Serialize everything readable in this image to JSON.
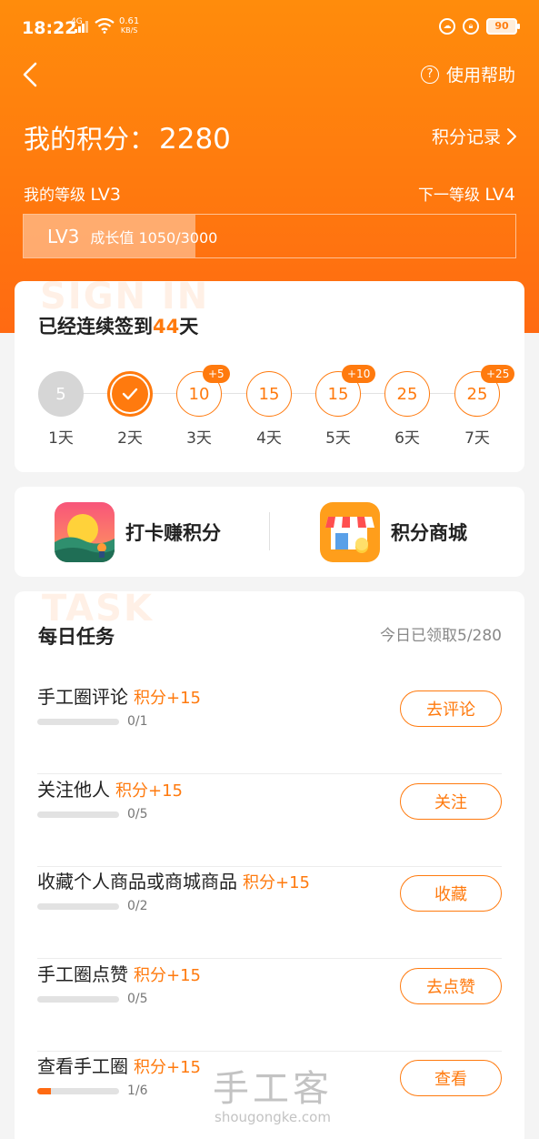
{
  "status_bar": {
    "time": "18:22",
    "network": "4G",
    "speed_value": "0.61",
    "speed_unit": "KB/S",
    "battery": "90"
  },
  "header": {
    "help_label": "使用帮助",
    "points_label": "我的积分：",
    "points_value": "2280",
    "records_label": "积分记录",
    "level_current_label": "我的等级",
    "level_current": "LV3",
    "level_next_label": "下一等级",
    "level_next": "LV4",
    "progress": {
      "level": "LV3",
      "growth_label": "成长值",
      "growth_value": "1050/3000",
      "current": 1050,
      "total": 3000
    }
  },
  "signin": {
    "watermark": "SIGN IN",
    "title_prefix": "已经连续签到",
    "streak": "44",
    "title_suffix": "天",
    "days": [
      {
        "label": "1天",
        "value": "5",
        "state": "done",
        "bonus": ""
      },
      {
        "label": "2天",
        "value": "",
        "state": "today",
        "bonus": ""
      },
      {
        "label": "3天",
        "value": "10",
        "state": "pending",
        "bonus": "+5"
      },
      {
        "label": "4天",
        "value": "15",
        "state": "pending",
        "bonus": ""
      },
      {
        "label": "5天",
        "value": "15",
        "state": "pending",
        "bonus": "+10"
      },
      {
        "label": "6天",
        "value": "25",
        "state": "pending",
        "bonus": ""
      },
      {
        "label": "7天",
        "value": "25",
        "state": "pending",
        "bonus": "+25"
      }
    ]
  },
  "features": [
    {
      "label": "打卡赚积分",
      "icon": "sunrise-icon"
    },
    {
      "label": "积分商城",
      "icon": "store-icon"
    }
  ],
  "tasks": {
    "watermark": "TASK",
    "title": "每日任务",
    "today_summary": "今日已领取5/280",
    "items": [
      {
        "name": "手工圈评论",
        "reward": "积分+15",
        "progress": "0/1",
        "done": 0,
        "total": 1,
        "button": "去评论"
      },
      {
        "name": "关注他人",
        "reward": "积分+15",
        "progress": "0/5",
        "done": 0,
        "total": 5,
        "button": "关注"
      },
      {
        "name": "收藏个人商品或商城商品",
        "reward": "积分+15",
        "progress": "0/2",
        "done": 0,
        "total": 2,
        "button": "收藏"
      },
      {
        "name": "手工圈点赞",
        "reward": "积分+15",
        "progress": "0/5",
        "done": 0,
        "total": 5,
        "button": "去点赞"
      },
      {
        "name": "查看手工圈",
        "reward": "积分+15",
        "progress": "1/6",
        "done": 1,
        "total": 6,
        "button": "查看"
      }
    ]
  },
  "brand_watermark": {
    "name": "手工客",
    "url": "shougongke.com"
  },
  "colors": {
    "accent": "#ff7a0e",
    "header_top": "#ff8c0c",
    "header_bottom": "#ff6a12",
    "completed_circle": "#d6d6d6"
  }
}
